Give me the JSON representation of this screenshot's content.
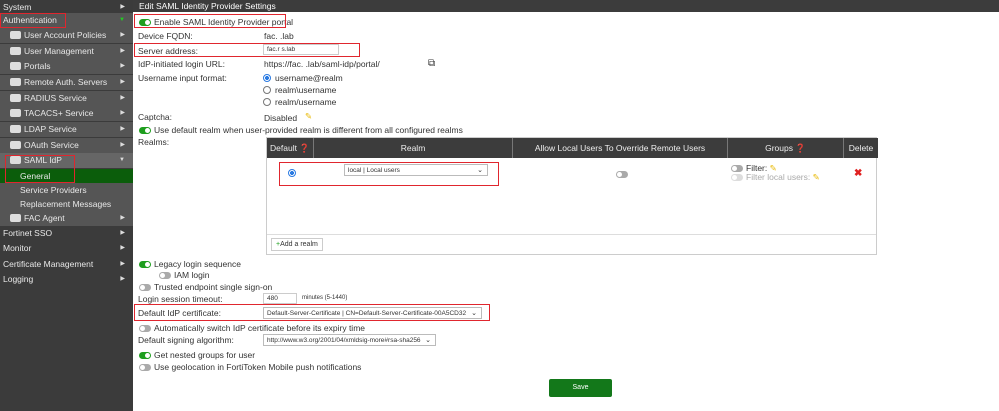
{
  "sidebar": {
    "items": [
      {
        "label": "System"
      },
      {
        "label": "Authentication"
      },
      {
        "label": "User Account Policies"
      },
      {
        "label": "User Management"
      },
      {
        "label": "Portals"
      },
      {
        "label": "Remote Auth. Servers"
      },
      {
        "label": "RADIUS Service"
      },
      {
        "label": "TACACS+ Service"
      },
      {
        "label": "LDAP Service"
      },
      {
        "label": "OAuth Service"
      },
      {
        "label": "SAML IdP"
      },
      {
        "label": "General"
      },
      {
        "label": "Service Providers"
      },
      {
        "label": "Replacement Messages"
      },
      {
        "label": "FAC Agent"
      },
      {
        "label": "Fortinet SSO"
      },
      {
        "label": "Monitor"
      },
      {
        "label": "Certificate Management"
      },
      {
        "label": "Logging"
      }
    ]
  },
  "header": {
    "title": "Edit SAML Identity Provider Settings"
  },
  "form": {
    "enable_portal": "Enable SAML Identity Provider portal",
    "fqdn_label": "Device FQDN:",
    "fqdn_value": "fac.            .lab",
    "server_label": "Server address:",
    "server_value": "fac.r          s.lab",
    "url_label": "IdP-initiated login URL:",
    "url_value": "https://fac.           .lab/saml-idp/portal/",
    "username_label": "Username input format:",
    "username_options": [
      "username@realm",
      "realm\\username",
      "realm/username"
    ],
    "captcha_label": "Captcha:",
    "captcha_value": "Disabled",
    "default_realm": "Use default realm when user-provided realm is different from all configured realms",
    "realms_label": "Realms:",
    "legacy": "Legacy login sequence",
    "iam": "IAM login",
    "trusted": "Trusted endpoint single sign-on",
    "timeout_label": "Login session timeout:",
    "timeout_value": "480",
    "timeout_hint": "minutes (5-1440)",
    "cert_label": "Default IdP certificate:",
    "cert_value": "Default-Server-Certificate | CN=Default-Server-Certificate-00A5CD32",
    "auto_switch": "Automatically switch IdP certificate before its expiry time",
    "sign_label": "Default signing algorithm:",
    "sign_value": "http://www.w3.org/2001/04/xmldsig-more#rsa-sha256",
    "nested": "Get nested groups for user",
    "geo": "Use geolocation in FortiToken Mobile push notifications",
    "save": "Save"
  },
  "table": {
    "headers": [
      "Default",
      "Realm",
      "Allow Local Users To Override Remote Users",
      "Groups",
      "Delete"
    ],
    "row": {
      "realm": "local | Local users",
      "filter": "Filter:",
      "filter_local": "Filter local users:"
    },
    "add": "Add a realm"
  }
}
